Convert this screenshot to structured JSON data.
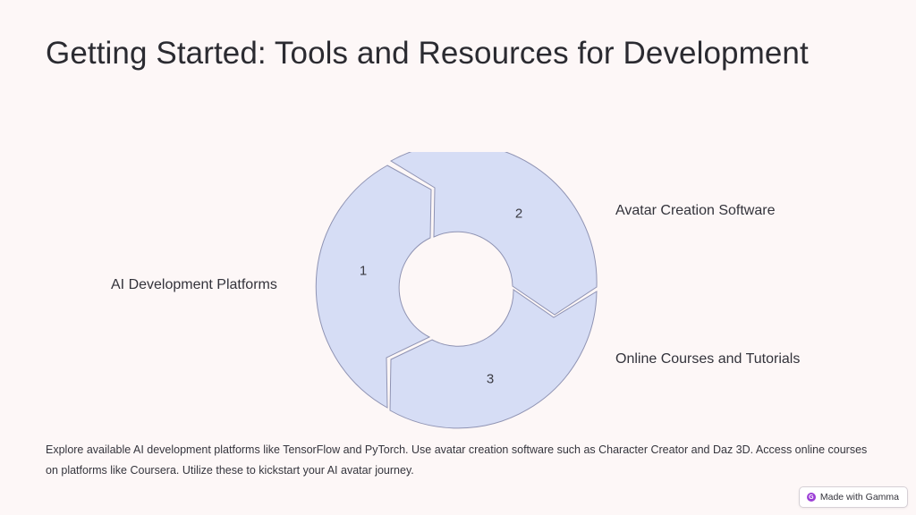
{
  "slide": {
    "title": "Getting Started: Tools and Resources for Development",
    "description": "Explore available AI development platforms like TensorFlow and PyTorch. Use avatar creation software such as Character Creator and Daz 3D. Access online courses on platforms like Coursera. Utilize these to kickstart your AI avatar journey."
  },
  "cycle": {
    "segments": [
      {
        "number": "1",
        "label": "AI Development Platforms"
      },
      {
        "number": "2",
        "label": "Avatar Creation Software"
      },
      {
        "number": "3",
        "label": "Online Courses and Tutorials"
      }
    ],
    "segment_color": "#d6ddf5",
    "segment_stroke": "#8f93b3"
  },
  "badge": {
    "label": "Made with Gamma",
    "icon": "gamma-logo-icon"
  }
}
